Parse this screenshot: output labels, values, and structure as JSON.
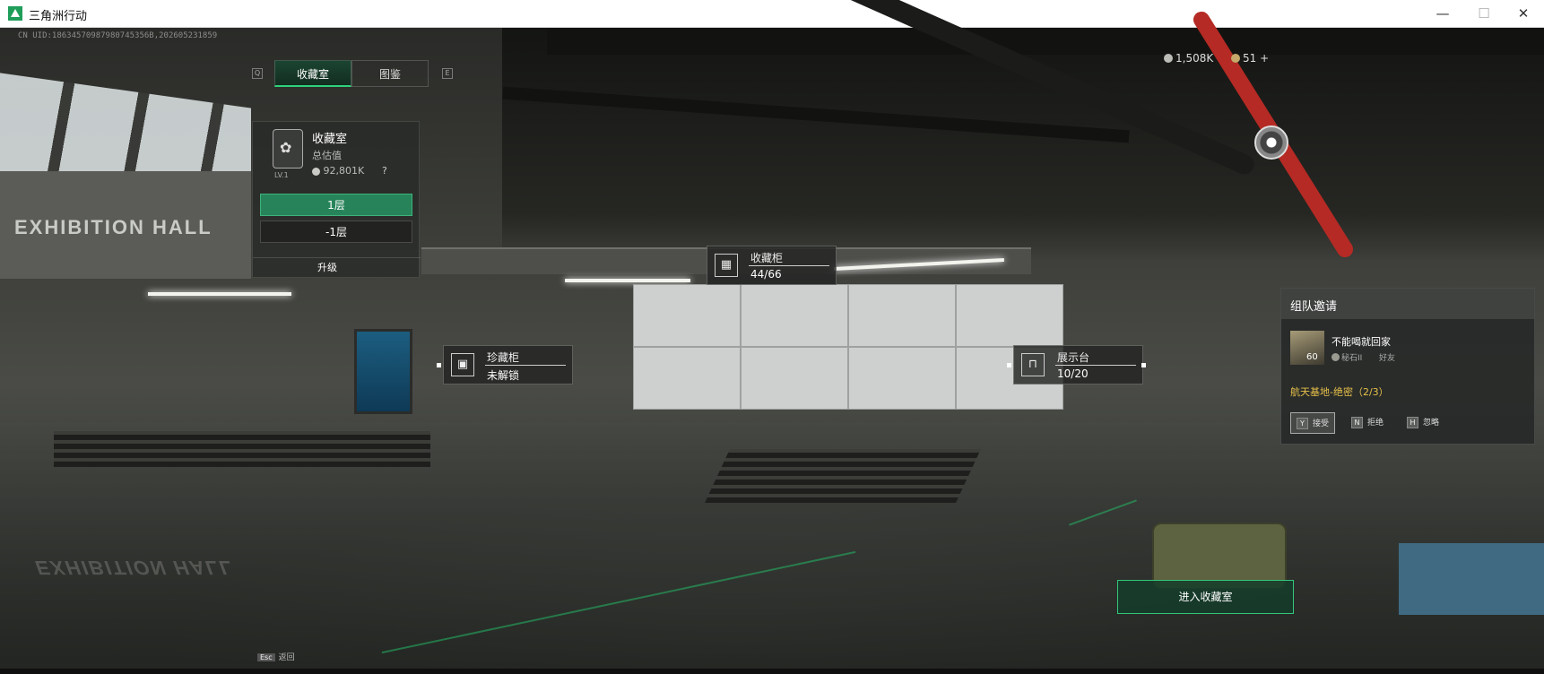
{
  "window": {
    "title": "三角洲行动",
    "controls": {
      "minimize": "—",
      "maximize": "☐",
      "close": "✕"
    }
  },
  "uid": "CN UID:18634570987980745356B,202605231859",
  "tabs": {
    "left_key": "Q",
    "right_key": "E",
    "items": [
      {
        "label": "收藏室",
        "active": true
      },
      {
        "label": "图鉴",
        "active": false
      }
    ]
  },
  "scene_text": {
    "hall_sign": "EXHIBITION HALL",
    "hall_reflection": "EXHIBITION HALL"
  },
  "room_card": {
    "title": "收藏室",
    "subtitle": "总估值",
    "level": "LV.1",
    "value": "92,801K",
    "help": "?",
    "floors": [
      {
        "label": "1层",
        "selected": true
      },
      {
        "label": "-1层",
        "selected": false
      }
    ],
    "upgrade_label": "升级"
  },
  "currency": {
    "silver": "1,508K",
    "gold": "51 +"
  },
  "hotspots": {
    "cabinet": {
      "title": "收藏柜",
      "value": "44/66",
      "icon": "grid-cabinet-icon"
    },
    "treasure": {
      "title": "珍藏柜",
      "value": "未解锁",
      "icon": "safe-icon"
    },
    "showcase": {
      "title": "展示台",
      "value": "10/20",
      "icon": "display-stand-icon"
    }
  },
  "team_invite": {
    "title": "组队邀请",
    "player_name": "不能喝就回家",
    "player_level": "60",
    "rank": "秘石II",
    "relation": "好友",
    "mission": "航天基地-绝密（2/3）",
    "buttons": [
      {
        "key": "Y",
        "label": "接受"
      },
      {
        "key": "N",
        "label": "拒绝"
      },
      {
        "key": "H",
        "label": "忽略"
      }
    ]
  },
  "enter_button": "进入收藏室",
  "footer": {
    "key": "Esc",
    "label": "返回"
  },
  "colors": {
    "accent_green": "#2ed27a",
    "mission_yellow": "#e7c04a"
  }
}
